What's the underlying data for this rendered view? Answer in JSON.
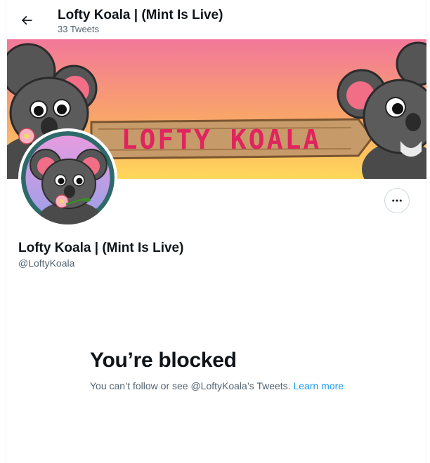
{
  "header": {
    "title": "Lofty Koala | (Mint Is Live)",
    "tweet_count": "33 Tweets"
  },
  "banner": {
    "sign_text": "LOFTY KOALA"
  },
  "profile": {
    "display_name": "Lofty Koala | (Mint Is Live)",
    "handle": "@LoftyKoala"
  },
  "blocked": {
    "title": "You’re blocked",
    "message": "You can’t follow or see @LoftyKoala’s Tweets.",
    "learn_more": "Learn more"
  },
  "icons": {
    "back": "arrow-left-icon",
    "more": "more-dots-icon"
  },
  "colors": {
    "accent": "#1d9bf0",
    "banner_top": "#f2789a",
    "banner_bottom": "#ffd85a",
    "sign_text": "#e0245e"
  }
}
